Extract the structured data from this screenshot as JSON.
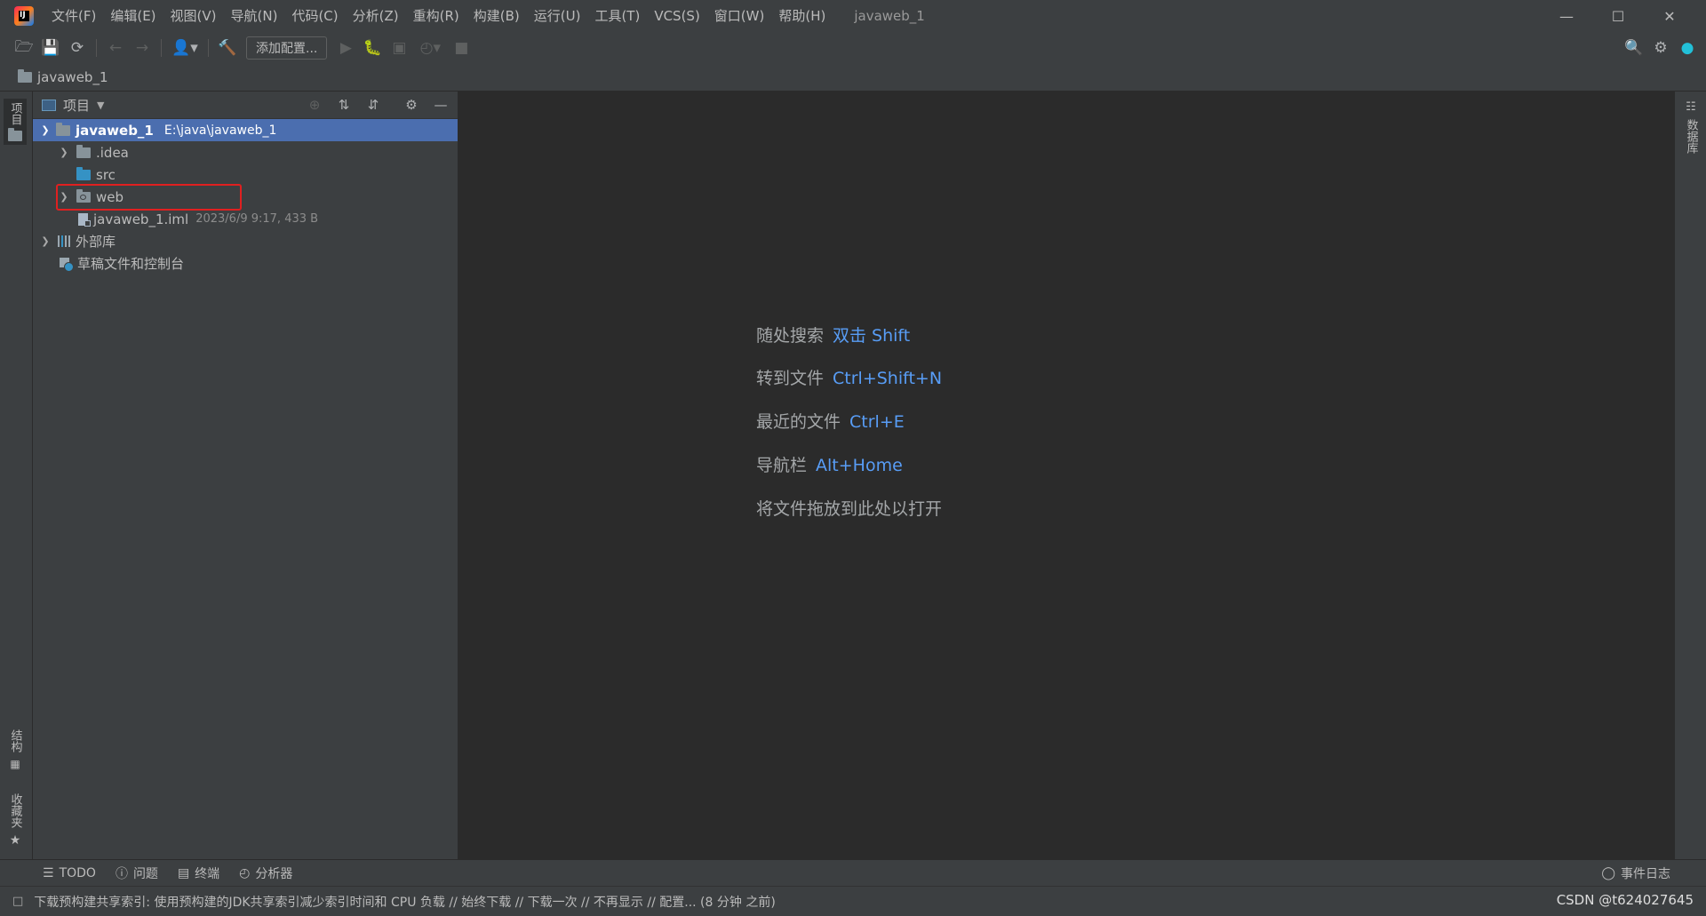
{
  "app": {
    "logo_text": "IJ",
    "window_title": "javaweb_1"
  },
  "menu": [
    "文件(F)",
    "编辑(E)",
    "视图(V)",
    "导航(N)",
    "代码(C)",
    "分析(Z)",
    "重构(R)",
    "构建(B)",
    "运行(U)",
    "工具(T)",
    "VCS(S)",
    "窗口(W)",
    "帮助(H)"
  ],
  "toolbar": {
    "add_config_label": "添加配置..."
  },
  "breadcrumb": {
    "project": "javaweb_1"
  },
  "left_strip": {
    "project_tab": "项目",
    "structure_tab": "结构",
    "favorites_tab": "收藏夹"
  },
  "right_strip": {
    "database_tab": "数据库"
  },
  "project_panel": {
    "title": "项目",
    "root": {
      "name": "javaweb_1",
      "path": "E:\\java\\javaweb_1"
    },
    "items": [
      {
        "name": ".idea"
      },
      {
        "name": "src"
      },
      {
        "name": "web"
      },
      {
        "name": "javaweb_1.iml",
        "meta": "2023/6/9 9:17, 433 B"
      },
      {
        "name": "外部库"
      },
      {
        "name": "草稿文件和控制台"
      }
    ]
  },
  "editor_hints": [
    {
      "label": "随处搜索",
      "key": "双击 Shift"
    },
    {
      "label": "转到文件",
      "key": "Ctrl+Shift+N"
    },
    {
      "label": "最近的文件",
      "key": "Ctrl+E"
    },
    {
      "label": "导航栏",
      "key": "Alt+Home"
    },
    {
      "label": "将文件拖放到此处以打开",
      "key": ""
    }
  ],
  "bottom_tabs": [
    "TODO",
    "问题",
    "终端",
    "分析器"
  ],
  "event_log_label": "事件日志",
  "status": {
    "message": "下载预构建共享索引: 使用预构建的JDK共享索引减少索引时间和 CPU 负载 // 始终下载 // 下载一次 // 不再显示 // 配置... (8 分钟 之前)",
    "watermark": "CSDN @t624027645"
  }
}
